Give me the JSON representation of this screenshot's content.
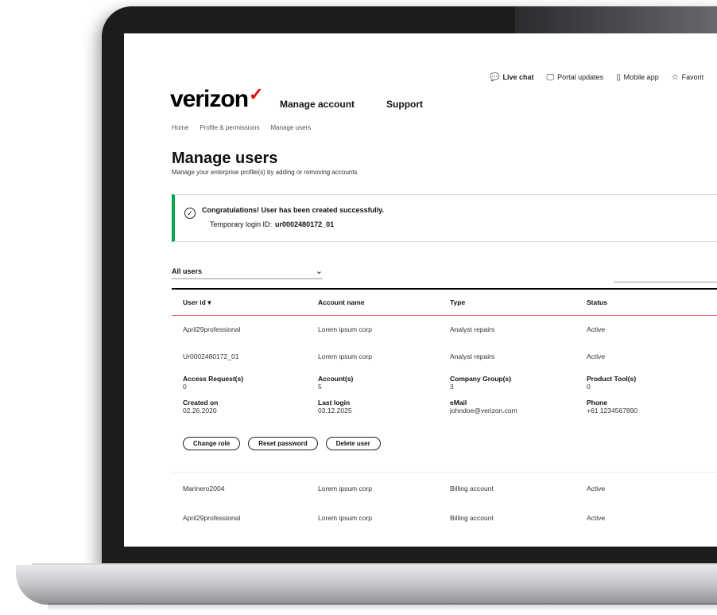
{
  "utility_links": [
    {
      "icon": "chat-icon",
      "label": "Live chat"
    },
    {
      "icon": "monitor-icon",
      "label": "Portal updates"
    },
    {
      "icon": "phone-icon",
      "label": "Mobile app"
    },
    {
      "icon": "star-icon",
      "label": "Favorit"
    }
  ],
  "brand": {
    "name": "verizon",
    "accent": "#e00000"
  },
  "nav": {
    "manage_account": "Manage account",
    "support": "Support"
  },
  "breadcrumb": [
    "Home",
    "Profile & permissions",
    "Manage users"
  ],
  "page": {
    "title": "Manage users",
    "subtitle": "Manage your enterprise profile(s) by adding or removing accounts"
  },
  "alert": {
    "message": "Congratulations! User has been created successfully.",
    "temp_label": "Temporary login ID:",
    "temp_id": "ur0002480172_01",
    "accent": "#00a34e"
  },
  "filter": {
    "label": "All users"
  },
  "table": {
    "headers": [
      "User id",
      "Account name",
      "Type",
      "Status"
    ],
    "rows": [
      [
        "April29professional",
        "Lorem ipsum corp",
        "Analyst repairs",
        "Active"
      ],
      [
        "Ur0002480172_01",
        "Lorem ipsum corp",
        "Analyst repairs",
        "Active"
      ]
    ],
    "detail": {
      "fields": [
        {
          "label": "Access Request(s)",
          "value": "0"
        },
        {
          "label": "Account(s)",
          "value": "5"
        },
        {
          "label": "Company Group(s)",
          "value": "3"
        },
        {
          "label": "Product Tool(s)",
          "value": "0"
        },
        {
          "label": "Created on",
          "value": "02.26.2020"
        },
        {
          "label": "Last login",
          "value": "03.12.2025"
        },
        {
          "label": "eMail",
          "value": "johndoe@verizon.com"
        },
        {
          "label": "Phone",
          "value": "+61 1234567890"
        }
      ],
      "actions": [
        "Change role",
        "Reset password",
        "Delete user"
      ]
    },
    "rows_after": [
      [
        "Marinero2004",
        "Lorem ipsum corp",
        "Billing account",
        "Active"
      ],
      [
        "April29professional",
        "Lorem ipsum corp",
        "Billing account",
        "Active"
      ]
    ]
  }
}
